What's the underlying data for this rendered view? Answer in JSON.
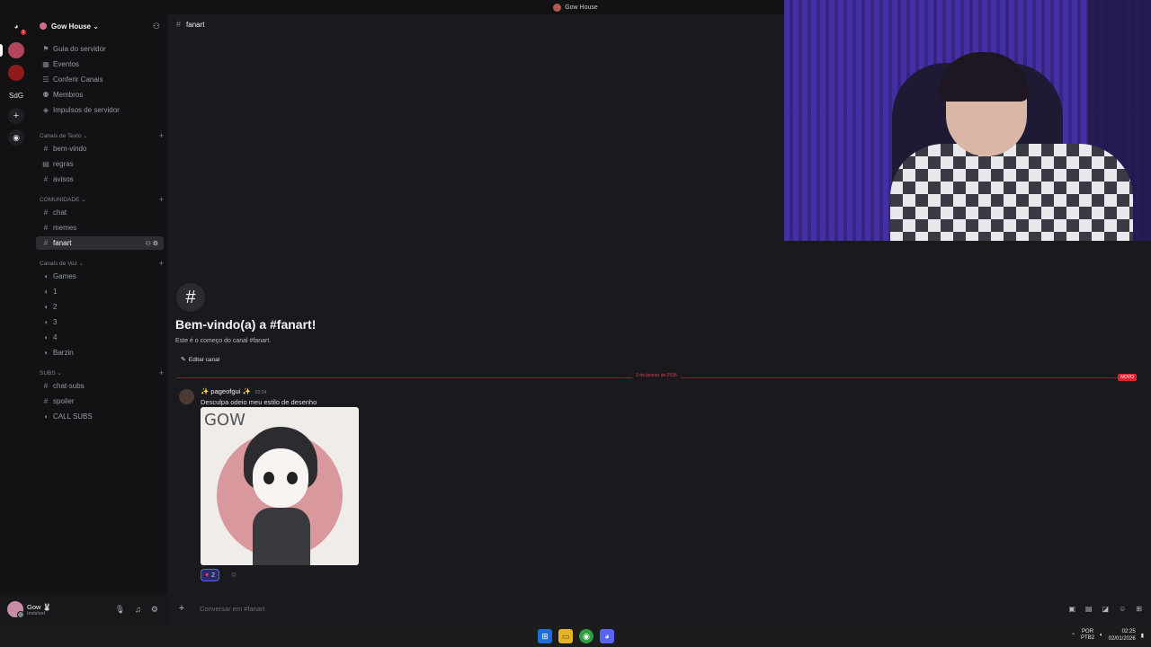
{
  "window": {
    "title": "Gow House"
  },
  "servers": {
    "sdg_label": "SdG",
    "dm_badge": "1"
  },
  "sidebar": {
    "server_name": "Gow House",
    "nav": [
      {
        "label": "Guia do servidor"
      },
      {
        "label": "Eventos"
      },
      {
        "label": "Conferir Canais"
      },
      {
        "label": "Membros"
      },
      {
        "label": "Impulsos de servidor"
      }
    ],
    "categories": {
      "text": "Canais de Texto",
      "community": "COMUNIDADE",
      "voice": "Canais de Voz",
      "subs": "SUBS"
    },
    "text_channels": [
      "bem-vindo",
      "regras",
      "avisos"
    ],
    "community_channels": [
      "chat",
      "memes",
      "fanart"
    ],
    "voice_channels": [
      "Games",
      "1",
      "2",
      "3",
      "4",
      "Barzin"
    ],
    "subs_channels": [
      "chat-subs",
      "spoiler",
      "CALL SUBS"
    ]
  },
  "user": {
    "name": "Gow 🐰",
    "status": "Invisível"
  },
  "channel": {
    "name": "fanart",
    "welcome_title": "Bem-vindo(a) a #fanart!",
    "welcome_sub": "Este é o começo do canal #fanart.",
    "edit_label": "Editar canal"
  },
  "divider": {
    "date": "2 de janeiro de 2026",
    "new_label": "NOVO"
  },
  "message": {
    "author": "✨ pageofgui ✨",
    "time": "02:24",
    "text": "Desculpa odeio meu estilo de desenho",
    "image_text": "GOW",
    "reaction_count": "2"
  },
  "composer": {
    "placeholder": "Conversar em #fanart"
  },
  "taskbar": {
    "lang_top": "POR",
    "lang_bottom": "PTB2",
    "time": "02:25",
    "date": "02/01/2026"
  },
  "colors": {
    "accent": "#5865f2",
    "danger": "#e0242f",
    "bg": "#1a1a1e",
    "sidebar": "#121214"
  }
}
